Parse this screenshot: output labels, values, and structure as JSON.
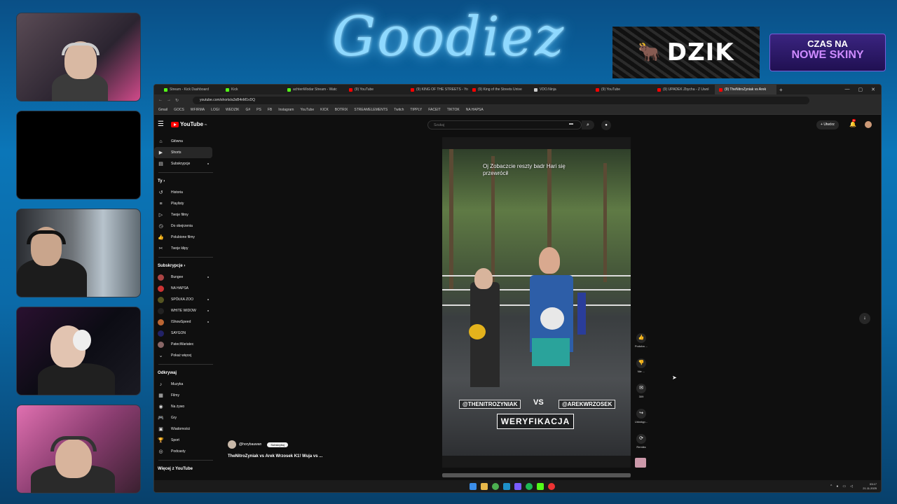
{
  "overlay": {
    "brand": "Goodiez",
    "sponsor": "DZIK",
    "promo_line1": "CZAS NA",
    "promo_line2": "NOWE SKINY"
  },
  "browser": {
    "tabs": [
      {
        "label": "Stream - Kick Dashboard",
        "color": "#53fc18"
      },
      {
        "label": "Kick",
        "color": "#53fc18"
      },
      {
        "label": "achtenWodar Stream - Watc",
        "color": "#53fc18"
      },
      {
        "label": "(9) YouTube",
        "color": "#ff0000"
      },
      {
        "label": "(9) KING OF THE STREETS - Yo",
        "color": "#ff0000"
      },
      {
        "label": "(9) King of the Streets Unive",
        "color": "#ff0000"
      },
      {
        "label": "VDO.Ninja",
        "color": "#cccccc"
      },
      {
        "label": "(9) YouTube",
        "color": "#ff0000"
      },
      {
        "label": "(9) UPADEK Zbycha - Z Uwol",
        "color": "#ff0000"
      },
      {
        "label": "(9) TheNitroZyniak vs Arek",
        "color": "#ff0000"
      }
    ],
    "new_tab": "+",
    "url": "youtube.com/shorts/a3xB4nM1vDQ",
    "bookmarks": [
      "Gmail",
      "GOCS",
      "WFIRMA",
      "LOGI",
      "WEDZIK",
      "G#",
      "PS",
      "FB",
      "Instagram",
      "YouTube",
      "KICK",
      "BOTRIX",
      "STREAMELEMENTS",
      "Twitch",
      "TIPPLY",
      "FACEIT",
      "TIKTOK",
      "NA HAPSA"
    ]
  },
  "youtube": {
    "logo": "YouTube",
    "logo_suffix": "PL",
    "search_placeholder": "Szukaj",
    "create_label": "Utwórz",
    "notif_count": "9+",
    "nav": [
      {
        "icon": "home-icon",
        "glyph": "⌂",
        "label": "Główna"
      },
      {
        "icon": "shorts-icon",
        "glyph": "▶",
        "label": "Shorts",
        "active": true
      },
      {
        "icon": "subscriptions-icon",
        "glyph": "▤",
        "label": "Subskrypcje"
      }
    ],
    "you_header": "Ty",
    "you_items": [
      {
        "icon": "history-icon",
        "glyph": "↺",
        "label": "Historia"
      },
      {
        "icon": "playlist-icon",
        "glyph": "≡",
        "label": "Playlisty"
      },
      {
        "icon": "your-videos-icon",
        "glyph": "▷",
        "label": "Twoje filmy"
      },
      {
        "icon": "watch-later-icon",
        "glyph": "◷",
        "label": "Do obejrzenia"
      },
      {
        "icon": "like-icon",
        "glyph": "👍",
        "label": "Polubione filmy"
      },
      {
        "icon": "clips-icon",
        "glyph": "✂",
        "label": "Twoje klipy"
      }
    ],
    "subs_header": "Subskrypcje",
    "subs": [
      {
        "label": "Bungee",
        "color": "#a44"
      },
      {
        "label": "NA HAPSA",
        "color": "#c33"
      },
      {
        "label": "SPÓŁKA ZOO",
        "color": "#552"
      },
      {
        "label": "WHITE WIDOW",
        "color": "#222"
      },
      {
        "label": "IShowSpeed",
        "color": "#b63"
      },
      {
        "label": "SAYGON",
        "color": "#226"
      },
      {
        "label": "PatecWariatec",
        "color": "#866"
      }
    ],
    "show_more": "Pokaż więcej",
    "explore_header": "Odkrywaj",
    "explore": [
      {
        "icon": "music-icon",
        "glyph": "♪",
        "label": "Muzyka"
      },
      {
        "icon": "film-icon",
        "glyph": "▦",
        "label": "Filmy"
      },
      {
        "icon": "live-icon",
        "glyph": "◉",
        "label": "Na żywo"
      },
      {
        "icon": "gaming-icon",
        "glyph": "🎮",
        "label": "Gry"
      },
      {
        "icon": "news-icon",
        "glyph": "▣",
        "label": "Wiadomości"
      },
      {
        "icon": "sport-icon",
        "glyph": "🏆",
        "label": "Sport"
      },
      {
        "icon": "podcast-icon",
        "glyph": "◎",
        "label": "Podcasty"
      }
    ],
    "more_header": "Więcej z YouTube"
  },
  "short": {
    "caption": "Oj Zobaczcie reszty badr Hari się przewrócił",
    "tag_left": "@THENITROZYNIAK",
    "vs": "VS",
    "tag_right": "@AREKWRZOSEK",
    "banner": "WERYFIKACJA",
    "channel": "@horybauwan",
    "subscribe": "Subskrybuj",
    "title": "TheNitroZyniak vs Arek Wrzosek K1! Wuja vs ...",
    "actions": [
      {
        "icon": "thumbs-up-icon",
        "glyph": "👍",
        "label": "Podoba ..."
      },
      {
        "icon": "thumbs-down-icon",
        "glyph": "👎",
        "label": "Nie ..."
      },
      {
        "icon": "comment-icon",
        "glyph": "✉",
        "label": "309"
      },
      {
        "icon": "share-icon",
        "glyph": "↪",
        "label": "Udostęp..."
      },
      {
        "icon": "remix-icon",
        "glyph": "⟳",
        "label": "Remiks"
      }
    ]
  },
  "taskbar": {
    "time": "03:17",
    "date": "21.11.2025"
  }
}
